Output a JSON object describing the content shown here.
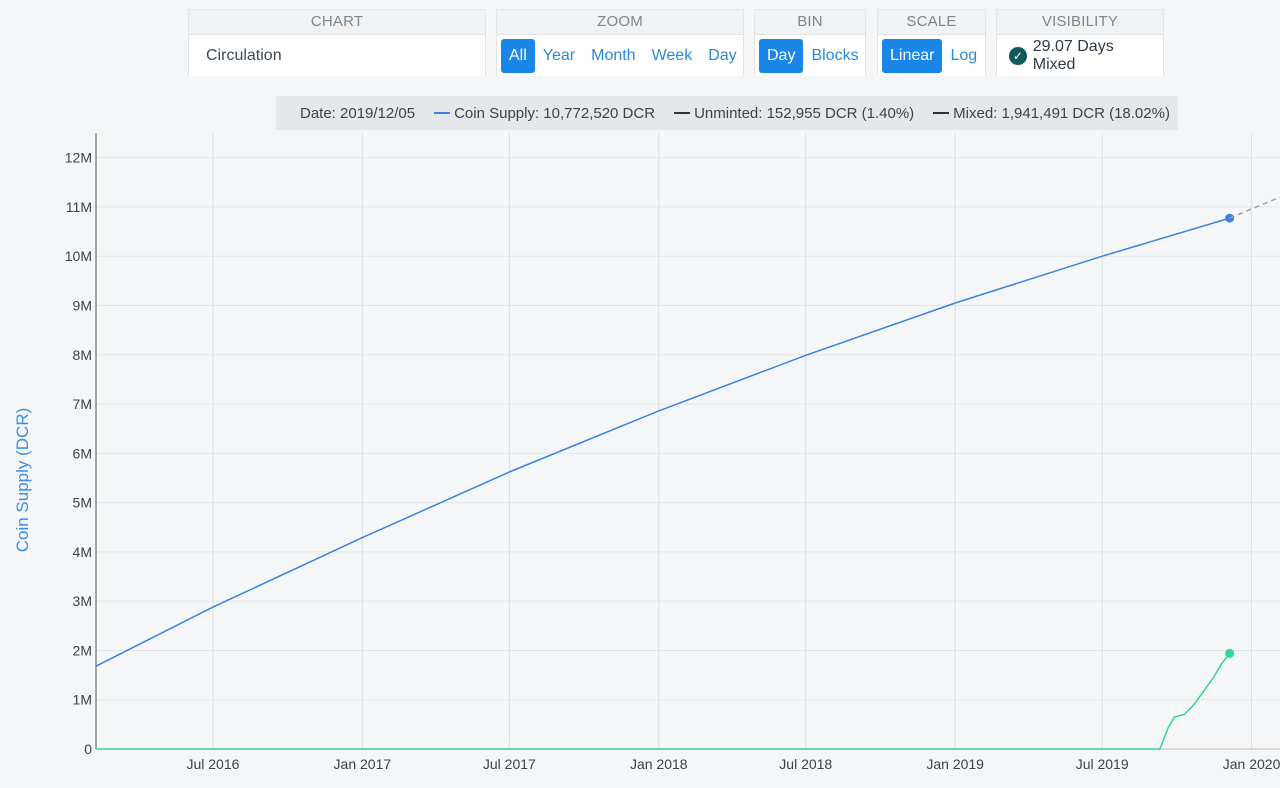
{
  "controls": {
    "chart": {
      "header": "CHART",
      "value": "Circulation"
    },
    "zoom": {
      "header": "ZOOM",
      "options": [
        "All",
        "Year",
        "Month",
        "Week",
        "Day"
      ],
      "active": "All"
    },
    "bin": {
      "header": "BIN",
      "options": [
        "Day",
        "Blocks"
      ],
      "active": "Day"
    },
    "scale": {
      "header": "SCALE",
      "options": [
        "Linear",
        "Log"
      ],
      "active": "Linear"
    },
    "visibility": {
      "header": "VISIBILITY",
      "label": "29.07 Days Mixed",
      "icon": "check-circle-icon"
    }
  },
  "legend": {
    "date": "Date: 2019/12/05",
    "items": [
      {
        "text": "Coin Supply: 10,772,520 DCR",
        "color": "#3b82e0"
      },
      {
        "text": "Unminted: 152,955 DCR (1.40%)",
        "color": "#333333"
      },
      {
        "text": "Mixed: 1,941,491 DCR (18.02%)",
        "color": "#333333"
      }
    ]
  },
  "chart_data": {
    "type": "line",
    "ylabel": "Coin Supply (DCR)",
    "xlabel": "",
    "ylim": [
      0,
      12500000
    ],
    "xlim": [
      "2016-02-08",
      "2020-02-05"
    ],
    "yticks": [
      0,
      1000000,
      2000000,
      3000000,
      4000000,
      5000000,
      6000000,
      7000000,
      8000000,
      9000000,
      10000000,
      11000000,
      12000000
    ],
    "ytick_labels": [
      "0",
      "1M",
      "2M",
      "3M",
      "4M",
      "5M",
      "6M",
      "7M",
      "8M",
      "9M",
      "10M",
      "11M",
      "12M"
    ],
    "xticks": [
      "2016-07-01",
      "2017-01-01",
      "2017-07-01",
      "2018-01-01",
      "2018-07-01",
      "2019-01-01",
      "2019-07-01",
      "2020-01-01"
    ],
    "xtick_labels": [
      "Jul 2016",
      "Jan 2017",
      "Jul 2017",
      "Jan 2018",
      "Jul 2018",
      "Jan 2019",
      "Jul 2019",
      "Jan 2020"
    ],
    "grid": true,
    "series": [
      {
        "name": "Coin Supply",
        "color": "#3b82e0",
        "points": [
          [
            "2016-02-08",
            1680000
          ],
          [
            "2016-07-01",
            2880000
          ],
          [
            "2017-01-01",
            4290000
          ],
          [
            "2017-07-01",
            5620000
          ],
          [
            "2018-01-01",
            6860000
          ],
          [
            "2018-07-01",
            7990000
          ],
          [
            "2019-01-01",
            9050000
          ],
          [
            "2019-07-01",
            10000000
          ],
          [
            "2019-12-05",
            10772520
          ]
        ],
        "marker_last": true
      },
      {
        "name": "Mixed",
        "color": "#2ed69a",
        "points": [
          [
            "2016-02-08",
            0
          ],
          [
            "2019-09-10",
            0
          ],
          [
            "2019-09-20",
            420000
          ],
          [
            "2019-09-28",
            650000
          ],
          [
            "2019-10-10",
            700000
          ],
          [
            "2019-10-22",
            900000
          ],
          [
            "2019-11-02",
            1150000
          ],
          [
            "2019-11-15",
            1450000
          ],
          [
            "2019-11-26",
            1750000
          ],
          [
            "2019-12-05",
            1941491
          ]
        ],
        "marker_last": true
      },
      {
        "name": "Coin Supply Projection",
        "color": "#9aa0a6",
        "dashed": true,
        "points": [
          [
            "2019-12-05",
            10772520
          ],
          [
            "2020-02-05",
            11200000
          ]
        ]
      }
    ]
  }
}
